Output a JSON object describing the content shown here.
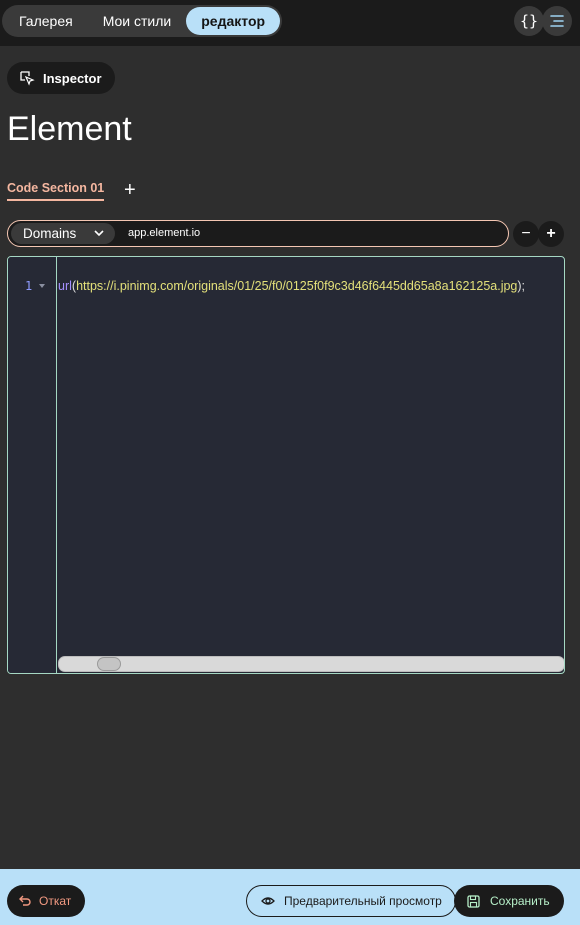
{
  "top_tabs": [
    {
      "label": "Галерея"
    },
    {
      "label": "Мои стили"
    },
    {
      "label": "редактор"
    }
  ],
  "header_icons": {
    "code": "curly-braces-icon",
    "menu": "menu-lines-icon"
  },
  "inspector": {
    "label": "Inspector",
    "icon": "cursor-select-icon"
  },
  "page_title": "Element",
  "section_tab": {
    "label": "Code Section 01"
  },
  "add_section_symbol": "+",
  "domain": {
    "select_label": "Domains",
    "value": "app.element.io"
  },
  "buttons_round": {
    "minus": "−",
    "plus": "+"
  },
  "editor": {
    "line_number": "1",
    "code": {
      "fn": "url",
      "open": "(",
      "arg": "https://i.pinimg.com/originals/01/25/f0/0125f0f9c3d46f6445dd65a8a162125a.jpg",
      "close": ");"
    }
  },
  "footer": {
    "back_label": "Откат",
    "preview_label": "Предварительный просмотр",
    "save_label": "Сохранить"
  },
  "colors": {
    "accent_blue": "#b9e0f8",
    "accent_peach": "#f5b7a0",
    "editor_bg": "#262935",
    "editor_border": "#a5d8c3"
  }
}
